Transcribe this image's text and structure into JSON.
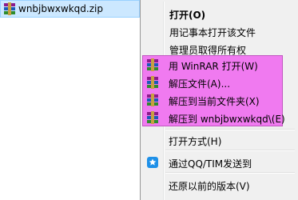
{
  "file": {
    "name": "wnbjbwxwkqd.zip",
    "icon": "winrar-archive-icon"
  },
  "menu": {
    "items": [
      {
        "label": "打开(O)",
        "bold": true
      },
      {
        "label": "用记事本打开该文件"
      },
      {
        "label": "管理员取得所有权"
      },
      {
        "label": "用 WinRAR 打开(W)",
        "icon": "winrar-icon"
      },
      {
        "label": "解压文件(A)...",
        "icon": "winrar-icon"
      },
      {
        "label": "解压到当前文件夹(X)",
        "icon": "winrar-icon"
      },
      {
        "label": "解压到 wnbjbwxwkqd\\(E)",
        "icon": "winrar-icon"
      },
      {
        "label": "打开方式(H)"
      },
      {
        "label": "通过QQ/TIM发送到",
        "icon": "qq-share-icon"
      },
      {
        "label": "还原以前的版本(V)"
      }
    ],
    "highlight_color": "#f07af0"
  }
}
